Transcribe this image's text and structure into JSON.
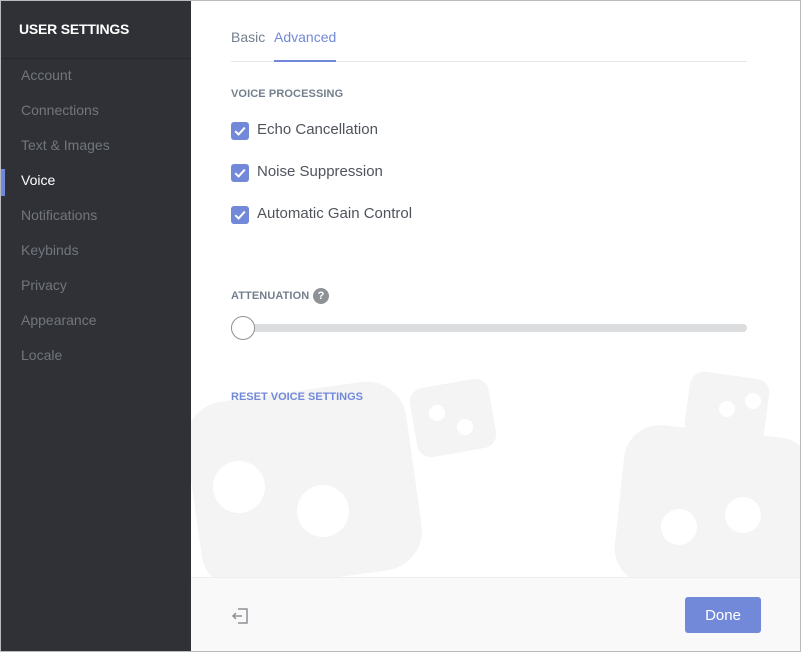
{
  "sidebar": {
    "title": "USER SETTINGS",
    "items": [
      {
        "label": "Account",
        "active": false
      },
      {
        "label": "Connections",
        "active": false
      },
      {
        "label": "Text & Images",
        "active": false
      },
      {
        "label": "Voice",
        "active": true
      },
      {
        "label": "Notifications",
        "active": false
      },
      {
        "label": "Keybinds",
        "active": false
      },
      {
        "label": "Privacy",
        "active": false
      },
      {
        "label": "Appearance",
        "active": false
      },
      {
        "label": "Locale",
        "active": false
      }
    ]
  },
  "tabs": [
    {
      "label": "Basic",
      "active": false
    },
    {
      "label": "Advanced",
      "active": true
    }
  ],
  "voice_processing": {
    "title": "VOICE PROCESSING",
    "options": [
      {
        "label": "Echo Cancellation",
        "checked": true
      },
      {
        "label": "Noise Suppression",
        "checked": true
      },
      {
        "label": "Automatic Gain Control",
        "checked": true
      }
    ]
  },
  "attenuation": {
    "title": "ATTENUATION",
    "help_icon": "question-mark",
    "value": 0
  },
  "reset_label": "RESET VOICE SETTINGS",
  "footer": {
    "logout_icon": "logout",
    "done_label": "Done"
  },
  "colors": {
    "accent": "#7289da",
    "sidebar_bg": "#2f3136",
    "muted_text": "#72767d"
  }
}
